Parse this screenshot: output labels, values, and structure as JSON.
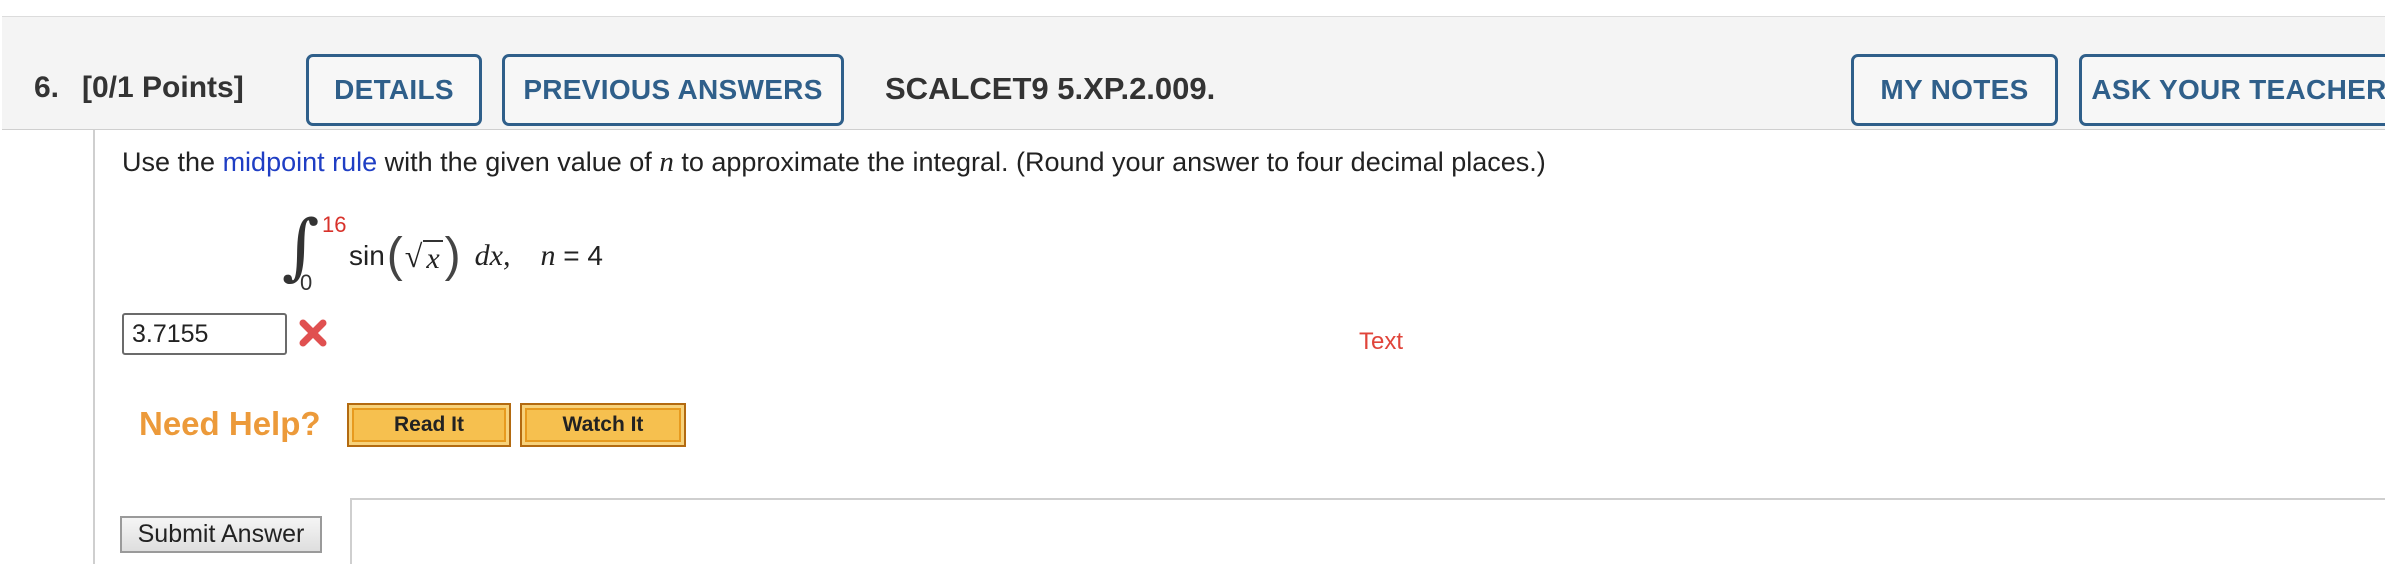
{
  "header": {
    "question_number": "6.",
    "points": "[0/1 Points]",
    "details_label": "DETAILS",
    "previous_answers_label": "PREVIOUS ANSWERS",
    "question_code": "SCALCET9 5.XP.2.009.",
    "my_notes_label": "MY NOTES",
    "ask_teacher_label": "ASK YOUR TEACHER"
  },
  "question": {
    "text_before_link": "Use the ",
    "link_text": "midpoint rule",
    "text_after_link": " with the given value of ",
    "variable": "n",
    "text_end": " to approximate the integral. (Round your answer to four decimal places.)"
  },
  "integral": {
    "upper_limit": "16",
    "lower_limit": "0",
    "function": "sin",
    "radicand": "x",
    "differential": "dx,",
    "n_label": "n",
    "n_value": "= 4"
  },
  "answer": {
    "value": "3.7155",
    "status": "incorrect",
    "status_color": "#e05050"
  },
  "text_label": "Text",
  "help": {
    "label": "Need Help?",
    "read_it": "Read It",
    "watch_it": "Watch It"
  },
  "submit_label": "Submit Answer",
  "colors": {
    "accent": "#2f5f8a",
    "link": "#1f3ec4",
    "help_orange": "#ec9a3a",
    "error_red": "#e0443a"
  }
}
